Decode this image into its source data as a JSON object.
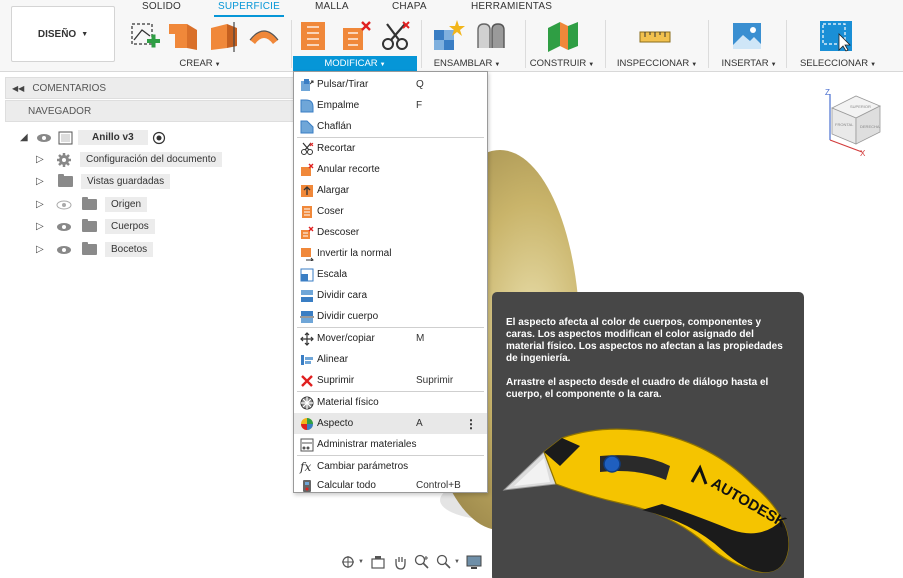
{
  "workspace": {
    "label": "DISEÑO"
  },
  "tabs": [
    {
      "label": "SOLIDO"
    },
    {
      "label": "SUPERFICIE"
    },
    {
      "label": "MALLA"
    },
    {
      "label": "CHAPA"
    },
    {
      "label": "HERRAMIENTAS"
    }
  ],
  "groups": {
    "crear": "CREAR",
    "modificar": "MODIFICAR",
    "ensamblar": "ENSAMBLAR",
    "construir": "CONSTRUIR",
    "inspeccionar": "INSPECCIONAR",
    "insertar": "INSERTAR",
    "seleccionar": "SELECCIONAR"
  },
  "panels": {
    "comments": "COMENTARIOS",
    "navigator": "NAVEGADOR"
  },
  "browser": {
    "root": "Anillo v3",
    "items": [
      {
        "label": "Configuración del documento",
        "icon": "gear-icon"
      },
      {
        "label": "Vistas guardadas",
        "icon": "folder-icon"
      },
      {
        "label": "Origen",
        "icon": "folder-icon"
      },
      {
        "label": "Cuerpos",
        "icon": "folder-icon"
      },
      {
        "label": "Bocetos",
        "icon": "folder-icon"
      }
    ]
  },
  "menu": {
    "items": [
      {
        "label": "Pulsar/Tirar",
        "shortcut": "Q",
        "icon": "press-pull-icon"
      },
      {
        "label": "Empalme",
        "shortcut": "F",
        "icon": "fillet-icon"
      },
      {
        "label": "Chaflán",
        "shortcut": "",
        "icon": "chamfer-icon"
      },
      {
        "label": "Recortar",
        "shortcut": "",
        "icon": "trim-icon"
      },
      {
        "label": "Anular recorte",
        "shortcut": "",
        "icon": "untrim-icon"
      },
      {
        "label": "Alargar",
        "shortcut": "",
        "icon": "extend-icon"
      },
      {
        "label": "Coser",
        "shortcut": "",
        "icon": "stitch-icon"
      },
      {
        "label": "Descoser",
        "shortcut": "",
        "icon": "unstitch-icon"
      },
      {
        "label": "Invertir la normal",
        "shortcut": "",
        "icon": "reverse-normal-icon"
      },
      {
        "label": "Escala",
        "shortcut": "",
        "icon": "scale-icon"
      },
      {
        "label": "Dividir cara",
        "shortcut": "",
        "icon": "split-face-icon"
      },
      {
        "label": "Dividir cuerpo",
        "shortcut": "",
        "icon": "split-body-icon"
      },
      {
        "label": "Mover/copiar",
        "shortcut": "M",
        "icon": "move-icon"
      },
      {
        "label": "Alinear",
        "shortcut": "",
        "icon": "align-icon"
      },
      {
        "label": "Suprimir",
        "shortcut": "Suprimir",
        "icon": "delete-icon"
      },
      {
        "label": "Material físico",
        "shortcut": "",
        "icon": "physical-material-icon"
      },
      {
        "label": "Aspecto",
        "shortcut": "A",
        "icon": "appearance-icon"
      },
      {
        "label": "Administrar materiales",
        "shortcut": "",
        "icon": "manage-materials-icon"
      },
      {
        "label": "Cambiar parámetros",
        "shortcut": "",
        "icon": "parameters-icon"
      },
      {
        "label": "Calcular todo",
        "shortcut": "Control+B",
        "icon": "compute-icon"
      }
    ]
  },
  "tooltip": {
    "p1": "El aspecto afecta al color de cuerpos, componentes y caras. Los aspectos modifican el color asignado del material físico. Los aspectos no afectan a las propiedades de ingeniería.",
    "p2": "Arrastre el aspecto desde el cuadro de diálogo hasta el cuerpo, el componente o la cara.",
    "brand": "AUTODESK"
  },
  "viewcube": {
    "front": "FRONTAL",
    "right": "DERECHA",
    "top": "SUPERIOR",
    "axis_z": "Z",
    "axis_x": "X"
  },
  "colors": {
    "accent": "#0696d7",
    "menu_icon_orange": "#f0883a",
    "tooltip_bg": "#474747"
  }
}
